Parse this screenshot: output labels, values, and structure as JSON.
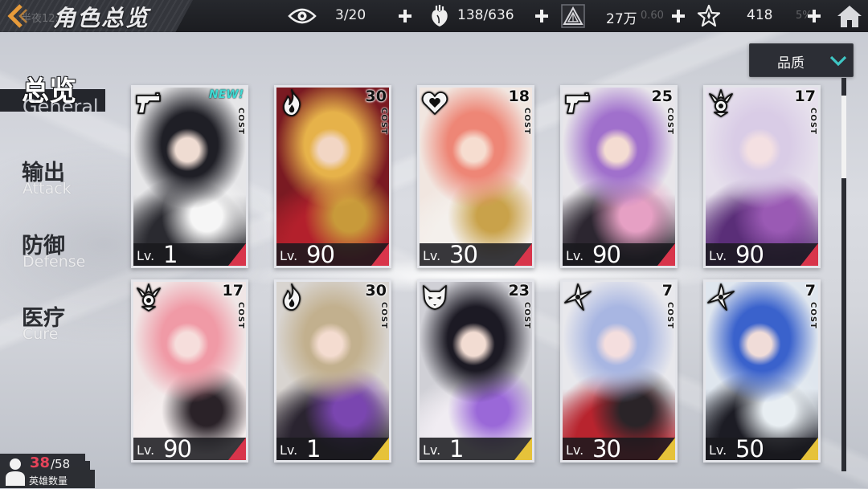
{
  "header": {
    "title": "角色总览",
    "status_time": "半夜12:",
    "status_speed": "0.60",
    "status_battery": "5%",
    "resources": [
      {
        "icon": "eye-icon",
        "value": "3/20"
      },
      {
        "icon": "anatomical-heart-icon",
        "value": "138/636"
      },
      {
        "icon": "triangle-crystal-icon",
        "value": "27万"
      },
      {
        "icon": "star-icon",
        "value": "418"
      }
    ]
  },
  "filter": {
    "label": "品质",
    "icon": "chevron-down-icon"
  },
  "sidebar": {
    "tabs": [
      {
        "label": "总览",
        "sublabel": "General",
        "active": true
      },
      {
        "label": "输出",
        "sublabel": "Attack",
        "active": false
      },
      {
        "label": "防御",
        "sublabel": "Defense",
        "active": false
      },
      {
        "label": "医疗",
        "sublabel": "Cure",
        "active": false
      }
    ]
  },
  "hero_count": {
    "current": "38",
    "total": "/58",
    "label": "英雄数量"
  },
  "cards": [
    {
      "class_icon": "pistol-icon",
      "cost_label": "COST",
      "badge": "NEW!",
      "lv_prefix": "Lv.",
      "level": "1",
      "corner_color": "#d8354b",
      "palette": {
        "bg": "#e6e6e8",
        "hair": "#1f1f26",
        "skin": "#efdcd2",
        "outfit": "#2a2a30",
        "accent": "#f6f6f6"
      }
    },
    {
      "class_icon": "flame-icon",
      "cost": "30",
      "cost_label": "COST",
      "lv_prefix": "Lv.",
      "level": "90",
      "corner_color": "#d8354b",
      "palette": {
        "bg": "#7a1a22",
        "hair": "#e6b24a",
        "skin": "#f2d6c4",
        "outfit": "#b3202c",
        "accent": "#c89a3a"
      }
    },
    {
      "class_icon": "heart-icon",
      "cost": "18",
      "cost_label": "COST",
      "lv_prefix": "Lv.",
      "level": "30",
      "corner_color": "#d8354b",
      "palette": {
        "bg": "#f1e6e0",
        "hair": "#ee8676",
        "skin": "#f6ddd0",
        "outfit": "#f4f0ec",
        "accent": "#c9a24a"
      }
    },
    {
      "class_icon": "pistol-icon",
      "cost": "25",
      "cost_label": "COST",
      "lv_prefix": "Lv.",
      "level": "90",
      "corner_color": "#d8354b",
      "palette": {
        "bg": "#e8e6ea",
        "hair": "#a070cc",
        "skin": "#f4dcd2",
        "outfit": "#2c2630",
        "accent": "#e6a0c4"
      }
    },
    {
      "class_icon": "crest-icon",
      "cost": "17",
      "cost_label": "COST",
      "lv_prefix": "Lv.",
      "level": "90",
      "corner_color": "#d8354b",
      "palette": {
        "bg": "#e6e0ec",
        "hair": "#d9cce6",
        "skin": "#f4e0e2",
        "outfit": "#5a2e78",
        "accent": "#9a5ab4"
      }
    },
    {
      "class_icon": "crest-icon",
      "cost": "17",
      "cost_label": "COST",
      "lv_prefix": "Lv.",
      "level": "90",
      "corner_color": "#d8354b",
      "palette": {
        "bg": "#f0e6e6",
        "hair": "#f09aa6",
        "skin": "#f6dedc",
        "outfit": "#f4eeee",
        "accent": "#2a2228"
      }
    },
    {
      "class_icon": "flame-icon",
      "cost": "30",
      "cost_label": "COST",
      "lv_prefix": "Lv.",
      "level": "1",
      "corner_color": "#e6c23a",
      "palette": {
        "bg": "#d8d4d0",
        "hair": "#c2b08e",
        "skin": "#f4dcd0",
        "outfit": "#2a2430",
        "accent": "#7a46b0"
      }
    },
    {
      "class_icon": "fox-mask-icon",
      "cost": "23",
      "cost_label": "COST",
      "lv_prefix": "Lv.",
      "level": "1",
      "corner_color": "#e6c23a",
      "palette": {
        "bg": "#d0d0d6",
        "hair": "#1c1a24",
        "skin": "#f2dcd2",
        "outfit": "#f0ecf2",
        "accent": "#9a68d8"
      }
    },
    {
      "class_icon": "shuriken-icon",
      "cost": "7",
      "cost_label": "COST",
      "lv_prefix": "Lv.",
      "level": "30",
      "corner_color": "#e6c23a",
      "palette": {
        "bg": "#e8e8ec",
        "hair": "#a8b6e2",
        "skin": "#f4dede",
        "outfit": "#b8242e",
        "accent": "#2a2428"
      }
    },
    {
      "class_icon": "shuriken-icon",
      "cost": "7",
      "cost_label": "COST",
      "lv_prefix": "Lv.",
      "level": "50",
      "corner_color": "#e6c23a",
      "palette": {
        "bg": "#dfe6ee",
        "hair": "#3a62cc",
        "skin": "#f0dcd8",
        "outfit": "#1c1c24",
        "accent": "#e8eef2"
      }
    }
  ],
  "colors": {
    "accent": "#3fc6c4",
    "back_arrow": "#e89b3a",
    "new_badge": "#3fd9d2",
    "hero_count": "#e8445a",
    "rarity_red": "#d8354b",
    "rarity_gold": "#e6c23a"
  }
}
